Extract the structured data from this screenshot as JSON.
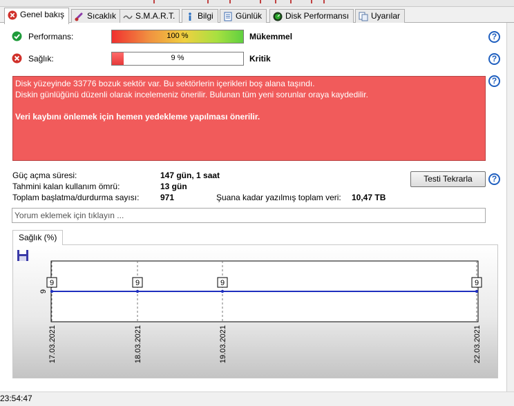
{
  "tabs": [
    {
      "label": "Genel bakış",
      "icon": "error-icon",
      "active": true
    },
    {
      "label": "Sıcaklık",
      "icon": "thermometer-icon",
      "active": false
    },
    {
      "label": "S.M.A.R.T.",
      "icon": "smart-icon",
      "active": false
    },
    {
      "label": "Bilgi",
      "icon": "info-icon",
      "active": false
    },
    {
      "label": "Günlük",
      "icon": "log-icon",
      "active": false
    },
    {
      "label": "Disk Performansı",
      "icon": "performance-icon",
      "active": false
    },
    {
      "label": "Uyarılar",
      "icon": "alerts-icon",
      "active": false
    }
  ],
  "performance": {
    "label": "Performans:",
    "percent_text": "100 %",
    "value": 100,
    "verdict": "Mükemmel",
    "status": "ok"
  },
  "health": {
    "label": "Sağlık:",
    "percent_text": "9 %",
    "value": 9,
    "verdict": "Kritik",
    "status": "error"
  },
  "alert": {
    "line1": "Disk yüzeyinde 33776 bozuk sektör var. Bu sektörlerin içerikleri boş alana taşındı.",
    "line2": "Diskin günlüğünü düzenli olarak incelemeniz önerilir. Bulunan tüm yeni sorunlar oraya kaydedilir.",
    "line3": "Veri kaybını önlemek için hemen yedekleme yapılması önerilir."
  },
  "info": {
    "power_on_label": "Güç açma süresi:",
    "power_on_value": "147 gün, 1 saat",
    "remaining_label": "Tahmini kalan kullanım ömrü:",
    "remaining_value": "13 gün",
    "startstop_label": "Toplam başlatma/durdurma sayısı:",
    "startstop_value": "971",
    "written_label": "Şuana kadar yazılmış toplam veri:",
    "written_value": "10,47 TB"
  },
  "retest_button": "Testi Tekrarla",
  "help_glyph": "?",
  "comment": {
    "placeholder": "Yorum eklemek için tıklayın ..."
  },
  "chart_tab": "Sağlık (%)",
  "chart_data": {
    "type": "line",
    "x": [
      "17.03.2021",
      "18.03.2021",
      "19.03.2021",
      "22.03.2021"
    ],
    "series": [
      {
        "values": [
          9,
          9,
          9,
          9
        ]
      }
    ],
    "y_tick": "9",
    "data_labels": [
      "9",
      "9",
      "9",
      "9"
    ],
    "grid": true,
    "line_color": "#1f2fbf"
  },
  "status_time": "23:54:47",
  "colors": {
    "ok": "#1e9b3a",
    "error": "#d0302a",
    "alert_bg": "#f15b5b",
    "accent": "#1f5fbf"
  }
}
